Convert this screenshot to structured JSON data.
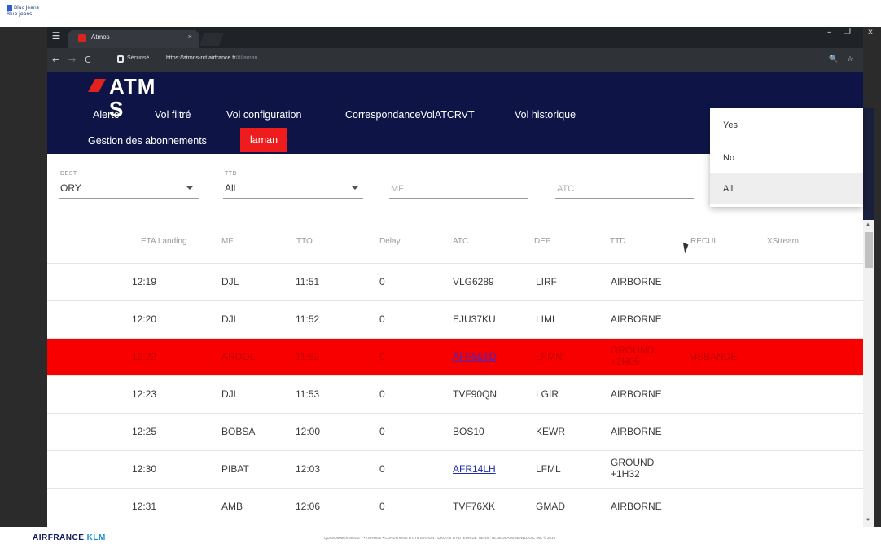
{
  "desktop": {
    "line1": "Bluc Jeans",
    "line2": "Blue Jeans"
  },
  "browser": {
    "tab_title": "Atmos",
    "tab_close": "×",
    "secure_label": "Sécurisé",
    "url_prefix": "https://",
    "url_host": "atmos-rct.airfrance.fr",
    "url_path": "/#/laman",
    "win_minimize": "–",
    "win_maximize": "❐",
    "win_close": "x",
    "zoom_icon": "🔍",
    "star_icon": "☆"
  },
  "app": {
    "logo_text": "ATM  S",
    "nav": [
      {
        "label": "Alerte"
      },
      {
        "label": "Vol filtré"
      },
      {
        "label": "Vol configuration"
      },
      {
        "label": "CorrespondanceVolATCRVT"
      },
      {
        "label": "Vol historique"
      },
      {
        "label": "Gestion des abonnements"
      },
      {
        "label": "laman",
        "active": true
      }
    ]
  },
  "filters": {
    "dest": {
      "label": "DEST",
      "value": "ORY"
    },
    "ttd": {
      "label": "TTD",
      "value": "All"
    },
    "mf": {
      "placeholder": "MF"
    },
    "atc": {
      "placeholder": "ATC"
    }
  },
  "dropdown": {
    "options": [
      "Yes",
      "No",
      "All"
    ],
    "selected": "All"
  },
  "table": {
    "headers": [
      "ETA Landing",
      "MF",
      "TTO",
      "Delay",
      "ATC",
      "DEP",
      "TTD",
      "RECUL",
      "XStream"
    ],
    "rows": [
      {
        "eta": "12:19",
        "mf": "DJL",
        "tto": "11:51",
        "delay": "0",
        "atc": "VLG6289",
        "dep": "LIRF",
        "ttd": "AIRBORNE",
        "recul": "",
        "link": false,
        "highlight": false
      },
      {
        "eta": "12:20",
        "mf": "DJL",
        "tto": "11:52",
        "delay": "0",
        "atc": "EJU37KU",
        "dep": "LIML",
        "ttd": "AIRBORNE",
        "recul": "",
        "link": false,
        "highlight": false
      },
      {
        "eta": "12:22",
        "mf": "ARDOL",
        "tto": "11:52",
        "delay": "0",
        "atc": "AFR55TD",
        "dep": "LFMN",
        "ttd": "GROUND +2H05",
        "recul": "MSBANDE",
        "link": true,
        "highlight": true
      },
      {
        "eta": "12:23",
        "mf": "DJL",
        "tto": "11:53",
        "delay": "0",
        "atc": "TVF90QN",
        "dep": "LGIR",
        "ttd": "AIRBORNE",
        "recul": "",
        "link": false,
        "highlight": false
      },
      {
        "eta": "12:25",
        "mf": "BOBSA",
        "tto": "12:00",
        "delay": "0",
        "atc": "BOS10",
        "dep": "KEWR",
        "ttd": "AIRBORNE",
        "recul": "",
        "link": false,
        "highlight": false
      },
      {
        "eta": "12:30",
        "mf": "PIBAT",
        "tto": "12:03",
        "delay": "0",
        "atc": "AFR14LH",
        "dep": "LFML",
        "ttd": "GROUND +1H32",
        "recul": "",
        "link": true,
        "highlight": false
      },
      {
        "eta": "12:31",
        "mf": "AMB",
        "tto": "12:06",
        "delay": "0",
        "atc": "TVF76XK",
        "dep": "GMAD",
        "ttd": "AIRBORNE",
        "recul": "",
        "link": false,
        "highlight": false
      }
    ]
  },
  "footer": {
    "brand": "AIRFRANCE",
    "brand2": "KLM",
    "links": "QUI SOMMES-NOUS ? • TERMES • CONDITIONS D'UTILISATION • DROITS D'AUTEUR DE TIERS · BLUE JEANS NEWLOOK, INC © 2019"
  },
  "colors": {
    "header_bg": "#0e1546",
    "accent_red": "#ee1c1c",
    "highlight_row": "#f80000",
    "link": "#1f2ea8"
  }
}
